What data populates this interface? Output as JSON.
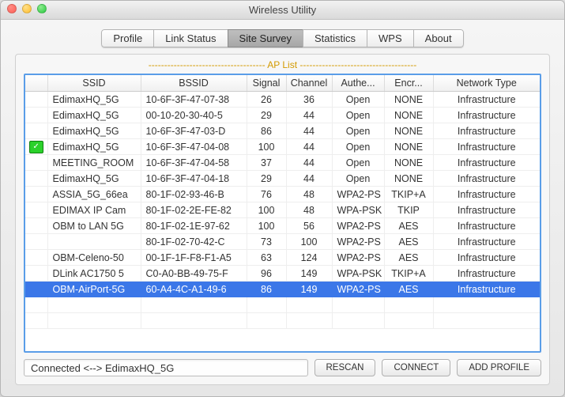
{
  "window": {
    "title": "Wireless Utility"
  },
  "tabs": [
    {
      "label": "Profile",
      "active": false
    },
    {
      "label": "Link Status",
      "active": false
    },
    {
      "label": "Site Survey",
      "active": true
    },
    {
      "label": "Statistics",
      "active": false
    },
    {
      "label": "WPS",
      "active": false
    },
    {
      "label": "About",
      "active": false
    }
  ],
  "panel": {
    "ap_list_label": "------------------------------------- AP List -------------------------------------"
  },
  "columns": [
    "",
    "SSID",
    "BSSID",
    "Signal",
    "Channel",
    "Authe...",
    "Encr...",
    "Network Type"
  ],
  "rows": [
    {
      "connected": false,
      "ssid": "EdimaxHQ_5G",
      "bssid": "10-6F-3F-47-07-38",
      "signal": 26,
      "channel": 36,
      "auth": "Open",
      "encr": "NONE",
      "net": "Infrastructure",
      "selected": false
    },
    {
      "connected": false,
      "ssid": "EdimaxHQ_5G",
      "bssid": "00-10-20-30-40-5",
      "signal": 29,
      "channel": 44,
      "auth": "Open",
      "encr": "NONE",
      "net": "Infrastructure",
      "selected": false
    },
    {
      "connected": false,
      "ssid": "EdimaxHQ_5G",
      "bssid": "10-6F-3F-47-03-D",
      "signal": 86,
      "channel": 44,
      "auth": "Open",
      "encr": "NONE",
      "net": "Infrastructure",
      "selected": false
    },
    {
      "connected": true,
      "ssid": "EdimaxHQ_5G",
      "bssid": "10-6F-3F-47-04-08",
      "signal": 100,
      "channel": 44,
      "auth": "Open",
      "encr": "NONE",
      "net": "Infrastructure",
      "selected": false
    },
    {
      "connected": false,
      "ssid": "MEETING_ROOM",
      "bssid": "10-6F-3F-47-04-58",
      "signal": 37,
      "channel": 44,
      "auth": "Open",
      "encr": "NONE",
      "net": "Infrastructure",
      "selected": false
    },
    {
      "connected": false,
      "ssid": "EdimaxHQ_5G",
      "bssid": "10-6F-3F-47-04-18",
      "signal": 29,
      "channel": 44,
      "auth": "Open",
      "encr": "NONE",
      "net": "Infrastructure",
      "selected": false
    },
    {
      "connected": false,
      "ssid": "ASSIA_5G_66ea",
      "bssid": "80-1F-02-93-46-B",
      "signal": 76,
      "channel": 48,
      "auth": "WPA2-PS",
      "encr": "TKIP+A",
      "net": "Infrastructure",
      "selected": false
    },
    {
      "connected": false,
      "ssid": "EDIMAX IP Cam",
      "bssid": "80-1F-02-2E-FE-82",
      "signal": 100,
      "channel": 48,
      "auth": "WPA-PSK",
      "encr": "TKIP",
      "net": "Infrastructure",
      "selected": false
    },
    {
      "connected": false,
      "ssid": "OBM to LAN 5G",
      "bssid": "80-1F-02-1E-97-62",
      "signal": 100,
      "channel": 56,
      "auth": "WPA2-PS",
      "encr": "AES",
      "net": "Infrastructure",
      "selected": false
    },
    {
      "connected": false,
      "ssid": "",
      "bssid": "80-1F-02-70-42-C",
      "signal": 73,
      "channel": 100,
      "auth": "WPA2-PS",
      "encr": "AES",
      "net": "Infrastructure",
      "selected": false
    },
    {
      "connected": false,
      "ssid": "OBM-Celeno-50",
      "bssid": "00-1F-1F-F8-F1-A5",
      "signal": 63,
      "channel": 124,
      "auth": "WPA2-PS",
      "encr": "AES",
      "net": "Infrastructure",
      "selected": false
    },
    {
      "connected": false,
      "ssid": "DLink AC1750 5",
      "bssid": "C0-A0-BB-49-75-F",
      "signal": 96,
      "channel": 149,
      "auth": "WPA-PSK",
      "encr": "TKIP+A",
      "net": "Infrastructure",
      "selected": false
    },
    {
      "connected": false,
      "ssid": "OBM-AirPort-5G",
      "bssid": "60-A4-4C-A1-49-6",
      "signal": 86,
      "channel": 149,
      "auth": "WPA2-PS",
      "encr": "AES",
      "net": "Infrastructure",
      "selected": true
    }
  ],
  "empty_rows": 2,
  "status": "Connected <--> EdimaxHQ_5G",
  "buttons": {
    "rescan": "RESCAN",
    "connect": "CONNECT",
    "add_profile": "ADD PROFILE"
  }
}
